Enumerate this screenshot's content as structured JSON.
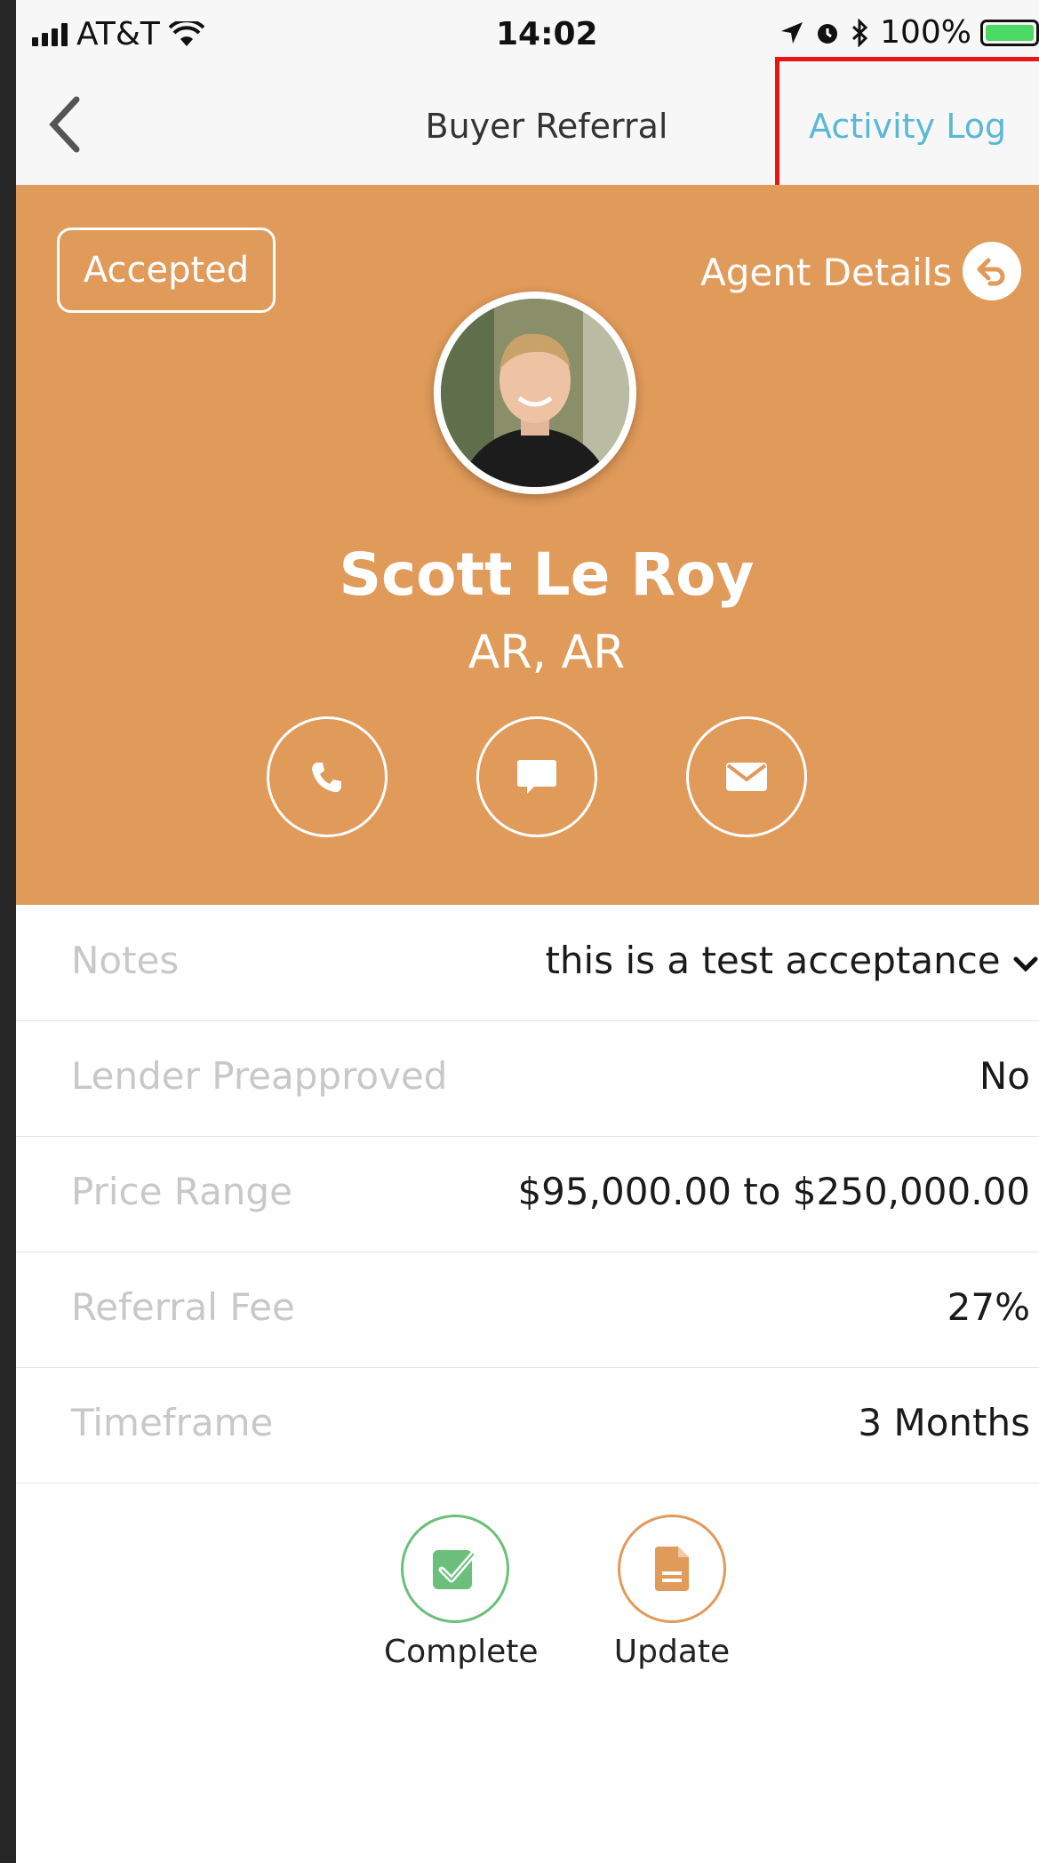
{
  "status_bar": {
    "carrier": "AT&T",
    "time": "14:02",
    "battery": "100%"
  },
  "nav": {
    "title": "Buyer Referral",
    "activity_log": "Activity Log"
  },
  "hero": {
    "status_badge": "Accepted",
    "agent_details": "Agent Details",
    "name": "Scott Le Roy",
    "location": "AR, AR",
    "background_color": "#e09a5a"
  },
  "details": [
    {
      "label": "Notes",
      "value": "this is a test acceptance"
    },
    {
      "label": "Lender Preapproved",
      "value": "No"
    },
    {
      "label": "Price Range",
      "value": "$95,000.00 to $250,000.00"
    },
    {
      "label": "Referral Fee",
      "value": "27%"
    },
    {
      "label": "Timeframe",
      "value": "3 Months"
    }
  ],
  "actions": {
    "complete": {
      "label": "Complete",
      "color": "#6bbf7a"
    },
    "update": {
      "label": "Update",
      "color": "#e09a5a"
    }
  },
  "icons": [
    "back-chevron-icon",
    "reply-arrow-icon",
    "phone-icon",
    "chat-icon",
    "mail-icon",
    "check-icon",
    "document-icon"
  ]
}
